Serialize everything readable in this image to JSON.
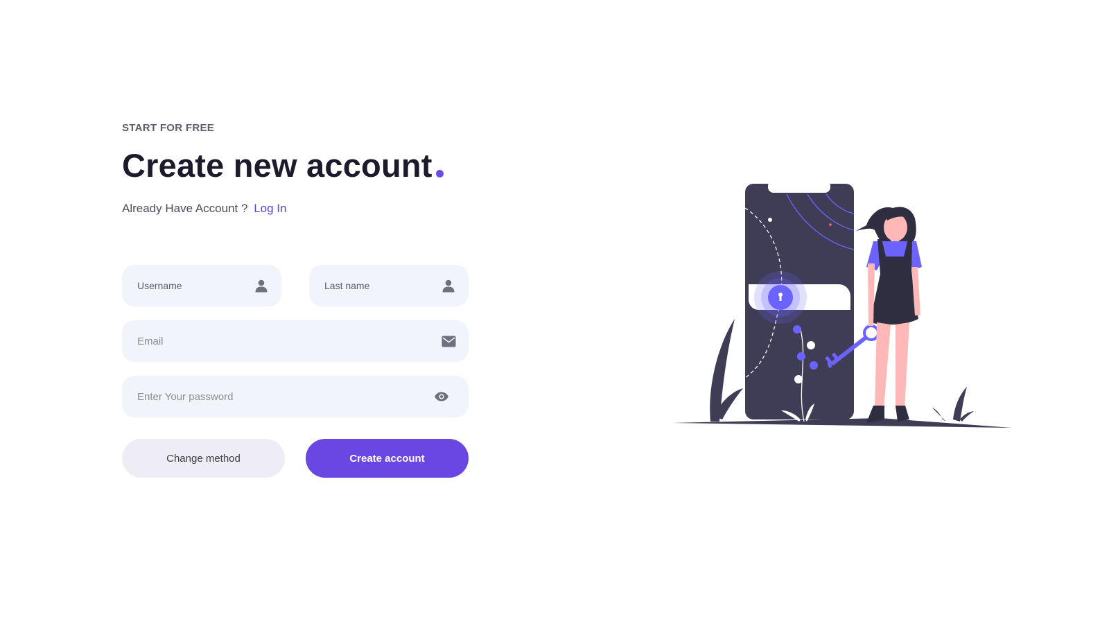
{
  "header": {
    "eyebrow": "START FOR FREE",
    "title": "Create new account",
    "subtitle_text": "Already Have Account ?",
    "login_link": "Log In"
  },
  "form": {
    "username_placeholder": "Username",
    "lastname_placeholder": "Last name",
    "email_placeholder": "Email",
    "password_placeholder": "Enter Your password"
  },
  "buttons": {
    "change_method": "Change method",
    "create_account": "Create account"
  },
  "icons": {
    "username": "user-icon",
    "lastname": "user-icon",
    "email": "envelope-icon",
    "password": "eye-icon"
  },
  "colors": {
    "accent": "#6a47e3",
    "field_bg": "#f1f4fa",
    "heading": "#1c1a2b"
  }
}
